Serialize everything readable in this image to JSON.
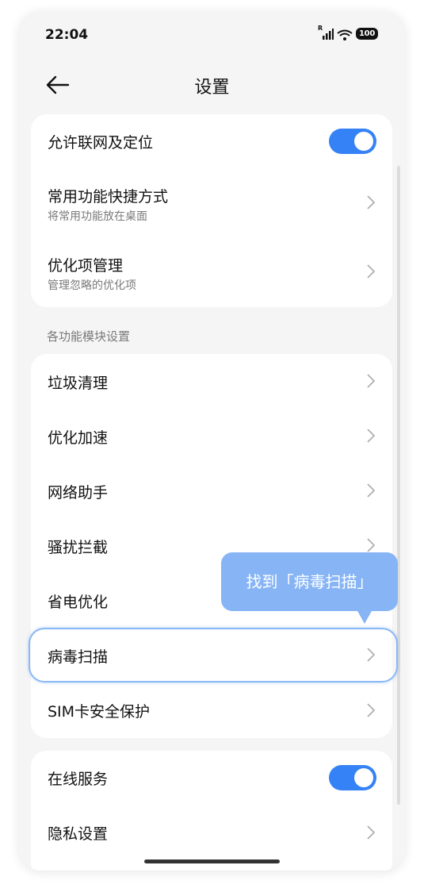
{
  "status": {
    "time": "22:04",
    "signal_label": "R",
    "battery": "100"
  },
  "header": {
    "title": "设置"
  },
  "top_card": {
    "allow_network": {
      "label": "允许联网及定位",
      "enabled": true
    },
    "shortcuts": {
      "label": "常用功能快捷方式",
      "sub": "将常用功能放在桌面"
    },
    "optimize_items": {
      "label": "优化项管理",
      "sub": "管理忽略的优化项"
    }
  },
  "module_section": {
    "title": "各功能模块设置",
    "items": [
      {
        "label": "垃圾清理"
      },
      {
        "label": "优化加速"
      },
      {
        "label": "网络助手"
      },
      {
        "label": "骚扰拦截"
      },
      {
        "label": "省电优化"
      },
      {
        "label": "病毒扫描"
      },
      {
        "label": "SIM卡安全保护"
      }
    ]
  },
  "bottom_card": {
    "online_service": {
      "label": "在线服务",
      "enabled": true
    },
    "privacy": {
      "label": "隐私设置"
    }
  },
  "tooltip": {
    "text": "找到「病毒扫描」"
  },
  "colors": {
    "accent": "#3482f6",
    "tooltip": "#86b4f5",
    "highlight_border": "#8ab8f5"
  }
}
